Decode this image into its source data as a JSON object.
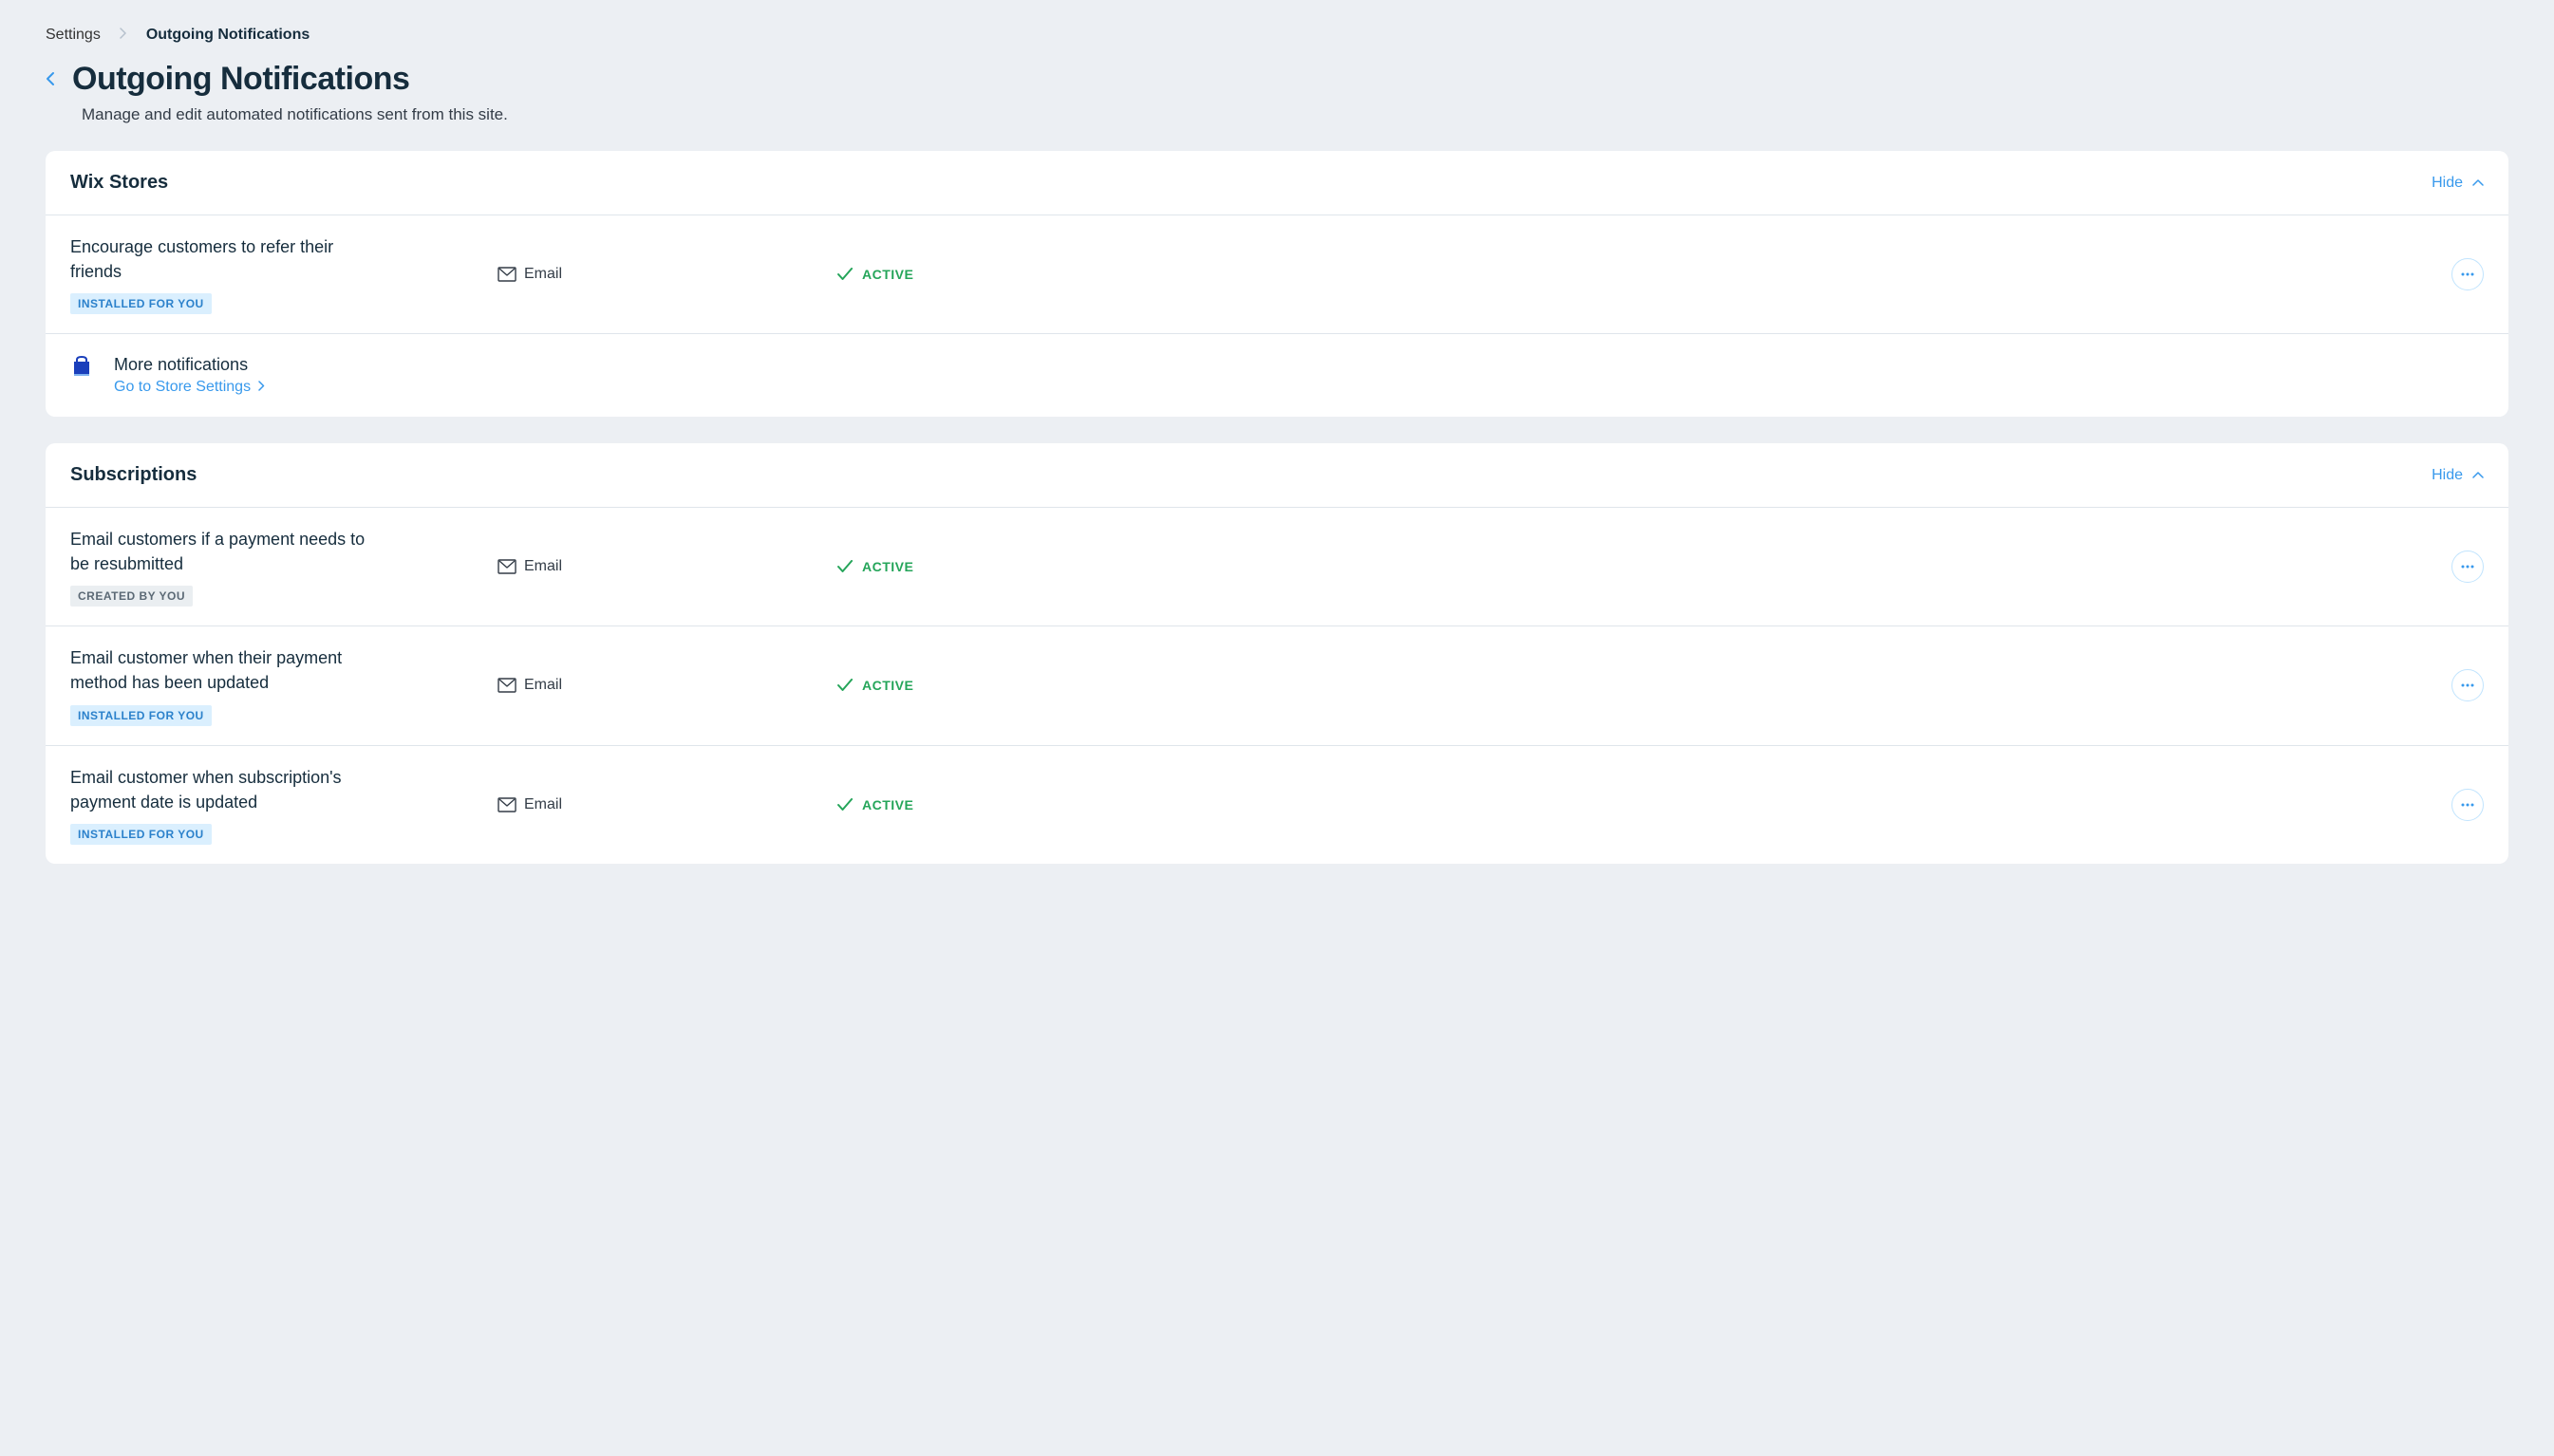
{
  "breadcrumb": {
    "root": "Settings",
    "current": "Outgoing Notifications"
  },
  "header": {
    "title": "Outgoing Notifications",
    "subtitle": "Manage and edit automated notifications sent from this site."
  },
  "hide_label": "Hide",
  "channel_label": "Email",
  "status_label": "ACTIVE",
  "tags": {
    "installed": "INSTALLED FOR YOU",
    "created": "CREATED BY YOU"
  },
  "sections": [
    {
      "title": "Wix Stores",
      "rows": [
        {
          "title": "Encourage customers to refer their friends",
          "tag": "installed"
        }
      ],
      "more": {
        "heading": "More notifications",
        "link": "Go to Store Settings"
      }
    },
    {
      "title": "Subscriptions",
      "rows": [
        {
          "title": "Email customers if a payment needs to be resubmitted",
          "tag": "created"
        },
        {
          "title": "Email customer when their payment method has been updated",
          "tag": "installed"
        },
        {
          "title": "Email customer when subscription's payment date is updated",
          "tag": "installed"
        }
      ]
    }
  ]
}
